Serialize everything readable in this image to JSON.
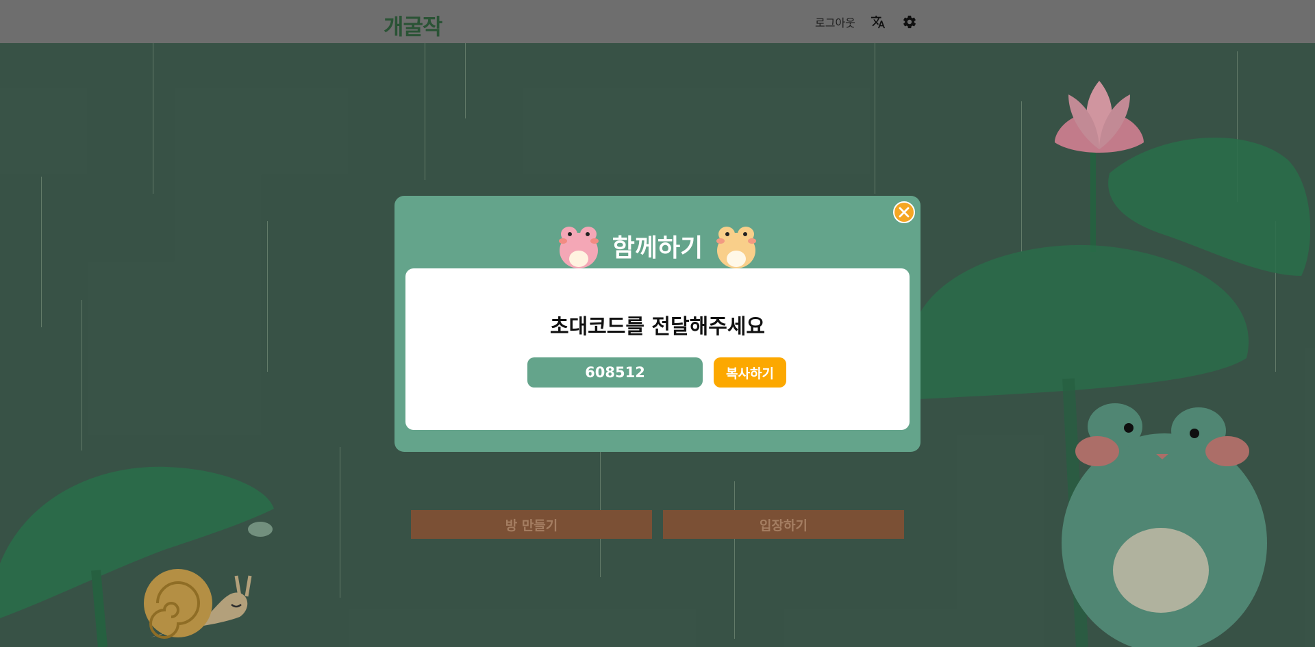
{
  "header": {
    "logo_text": "개굴작",
    "logout_label": "로그아웃",
    "translate_icon": "translate-icon",
    "settings_icon": "gear-icon"
  },
  "background": {
    "create_room_label": "방 만들기",
    "enter_room_label": "입장하기"
  },
  "modal": {
    "title": "함께하기",
    "subtitle": "초대코드를 전달해주세요",
    "invite_code": "608512",
    "copy_label": "복사하기",
    "close_icon": "close-icon"
  },
  "colors": {
    "modal_bg": "#64a48b",
    "accent": "#fca800",
    "header_bg": "#7b7b7b",
    "scene_bg": "#3f5c4f"
  }
}
